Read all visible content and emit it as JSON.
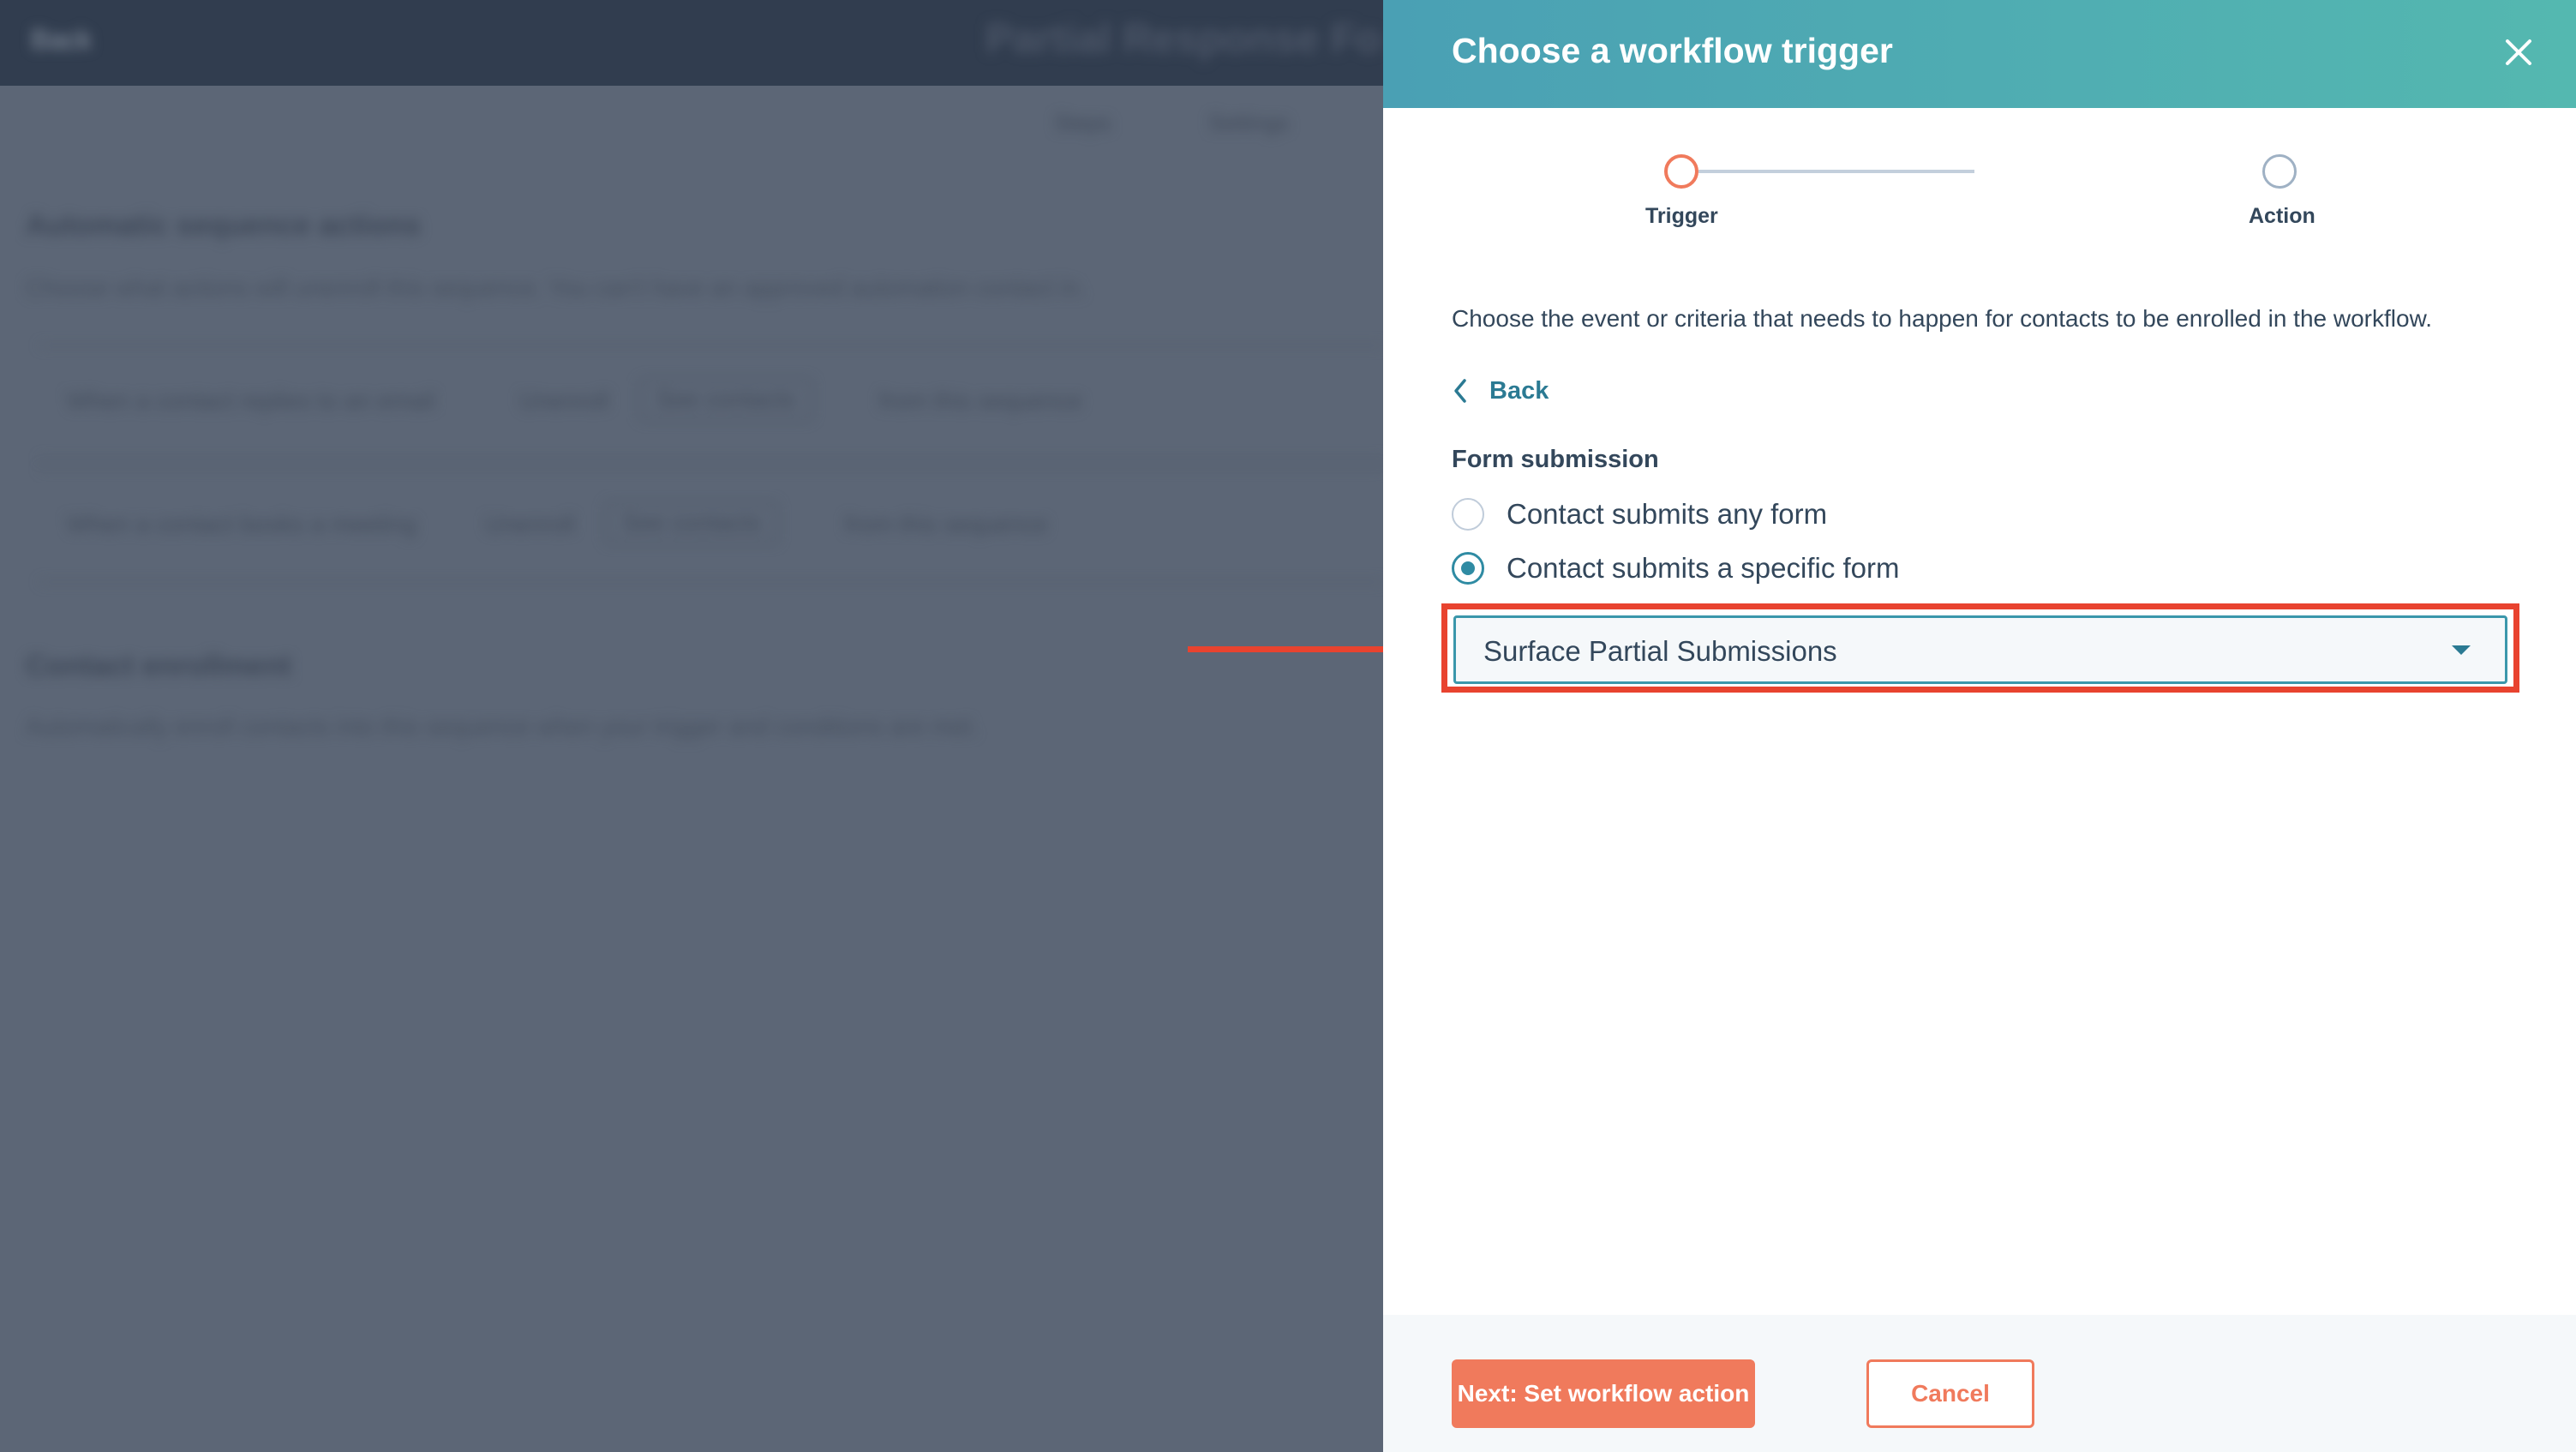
{
  "background": {
    "back_label": "Back",
    "page_title": "Partial Response Fo",
    "tabs": [
      "Steps",
      "Settings"
    ],
    "section1_title": "Automatic sequence actions",
    "section1_desc": "Choose what actions will unenroll this sequence. You can't have an approved automation contact in.",
    "row1": {
      "text": "When a contact replies to an email",
      "tag": "Unenroll",
      "link": "See contacts",
      "action": "from this sequence"
    },
    "row2": {
      "text": "When a contact books a meeting",
      "tag": "Unenroll",
      "link": "See contacts",
      "action": "from this sequence"
    },
    "section2_title": "Contact enrollment",
    "section2_desc": "Automatically enroll contacts into this sequence when your trigger and conditions are met."
  },
  "panel": {
    "title": "Choose a workflow trigger",
    "steps": [
      {
        "label": "Trigger",
        "state": "active"
      },
      {
        "label": "Action",
        "state": "inactive"
      }
    ],
    "description": "Choose the event or criteria that needs to happen for contacts to be enrolled in the workflow.",
    "back_label": "Back",
    "section_title": "Form submission",
    "options": [
      {
        "label": "Contact submits any form",
        "checked": false
      },
      {
        "label": "Contact submits a specific form",
        "checked": true
      }
    ],
    "dropdown_value": "Surface Partial Submissions",
    "next_label": "Next: Set workflow action",
    "cancel_label": "Cancel"
  },
  "colors": {
    "header_start": "#4aa0b4",
    "header_end": "#54b8b0",
    "accent": "#f07a5c",
    "link": "#2b7a93",
    "annotation": "#e8432f",
    "overlay": "#5c6676"
  },
  "icons": [
    "close-icon",
    "chevron-left-icon",
    "caret-down-icon",
    "annotation-arrow"
  ]
}
